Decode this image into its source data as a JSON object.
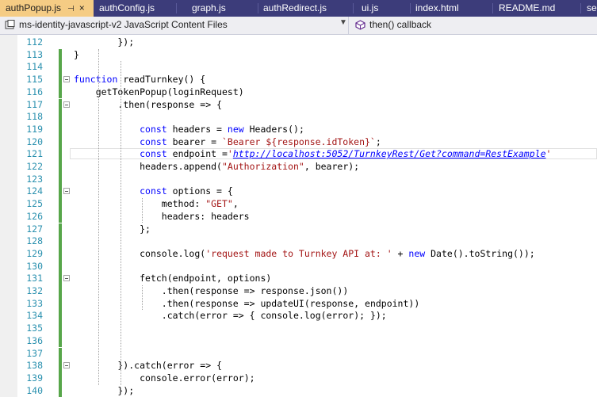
{
  "tabs": [
    {
      "label": "authPopup.js",
      "active": true
    },
    {
      "label": "authConfig.js",
      "active": false
    },
    {
      "label": "graph.js",
      "active": false
    },
    {
      "label": "authRedirect.js",
      "active": false
    },
    {
      "label": "ui.js",
      "active": false
    },
    {
      "label": "index.html",
      "active": false
    },
    {
      "label": "README.md",
      "active": false
    },
    {
      "label": "se",
      "active": false
    }
  ],
  "navbar": {
    "project": "ms-identity-javascript-v2 JavaScript Content Files",
    "member": "then() callback"
  },
  "colors": {
    "tab_active": "#f5cc84",
    "tab_strip": "#3c3c7a",
    "keyword": "#0000ff",
    "string": "#a31515",
    "line_number": "#2b91af",
    "change_bar": "#57a64a"
  },
  "editor": {
    "lines": [
      {
        "num": "112",
        "text": "        });"
      },
      {
        "num": "113",
        "text": "}"
      },
      {
        "num": "114",
        "text": ""
      },
      {
        "num": "115",
        "text": "function readTurnkey() {"
      },
      {
        "num": "116",
        "text": "    getTokenPopup(loginRequest)"
      },
      {
        "num": "117",
        "text": "        .then(response => {"
      },
      {
        "num": "118",
        "text": ""
      },
      {
        "num": "119",
        "text": "            const headers = new Headers();"
      },
      {
        "num": "120",
        "text": "            const bearer = `Bearer ${response.idToken}`;"
      },
      {
        "num": "121",
        "text": "            const endpoint ='http://localhost:5052/TurnkeyRest/Get?command=RestExample'"
      },
      {
        "num": "122",
        "text": "            headers.append(\"Authorization\", bearer);"
      },
      {
        "num": "123",
        "text": ""
      },
      {
        "num": "124",
        "text": "            const options = {"
      },
      {
        "num": "125",
        "text": "                method: \"GET\","
      },
      {
        "num": "126",
        "text": "                headers: headers"
      },
      {
        "num": "127",
        "text": "            };"
      },
      {
        "num": "128",
        "text": ""
      },
      {
        "num": "129",
        "text": "            console.log('request made to Turnkey API at: ' + new Date().toString());"
      },
      {
        "num": "130",
        "text": ""
      },
      {
        "num": "131",
        "text": "            fetch(endpoint, options)"
      },
      {
        "num": "132",
        "text": "                .then(response => response.json())"
      },
      {
        "num": "133",
        "text": "                .then(response => updateUI(response, endpoint))"
      },
      {
        "num": "134",
        "text": "                .catch(error => { console.log(error); });"
      },
      {
        "num": "135",
        "text": ""
      },
      {
        "num": "136",
        "text": ""
      },
      {
        "num": "137",
        "text": ""
      },
      {
        "num": "138",
        "text": "        }).catch(error => {"
      },
      {
        "num": "139",
        "text": "            console.error(error);"
      },
      {
        "num": "140",
        "text": "        });"
      }
    ]
  }
}
